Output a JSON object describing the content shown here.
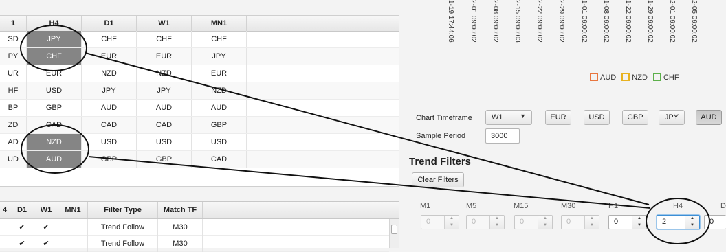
{
  "strength_table": {
    "headers": [
      "1",
      "H4",
      "D1",
      "W1",
      "MN1"
    ],
    "rows": [
      [
        "SD",
        "JPY",
        "CHF",
        "CHF",
        "CHF"
      ],
      [
        "PY",
        "CHF",
        "EUR",
        "EUR",
        "JPY"
      ],
      [
        "UR",
        "EUR",
        "NZD",
        "NZD",
        "EUR"
      ],
      [
        "HF",
        "USD",
        "JPY",
        "JPY",
        "NZD"
      ],
      [
        "BP",
        "GBP",
        "AUD",
        "AUD",
        "AUD"
      ],
      [
        "ZD",
        "CAD",
        "CAD",
        "CAD",
        "GBP"
      ],
      [
        "AD",
        "NZD",
        "USD",
        "USD",
        "USD"
      ],
      [
        "UD",
        "AUD",
        "GBP",
        "GBP",
        "CAD"
      ]
    ]
  },
  "filter_table": {
    "headers": [
      "4",
      "D1",
      "W1",
      "MN1",
      "Filter Type",
      "Match TF"
    ],
    "rows": [
      [
        "",
        "✔",
        "✔",
        "",
        "Trend Follow",
        "M30"
      ],
      [
        "",
        "✔",
        "✔",
        "",
        "Trend Follow",
        "M30"
      ]
    ]
  },
  "chart": {
    "dates": [
      "1-19 17:44:06",
      "2-01 09:00:02",
      "2-08 09:00:02",
      "2-15 09:00:03",
      "2-22 09:00:02",
      "2-29 09:00:02",
      "1-01 09:00:02",
      "1-08 09:00:02",
      "1-22 09:00:02",
      "1-29 09:00:02",
      "2-01 09:00:02",
      "2-05 09:00:02"
    ],
    "legend": [
      {
        "label": "AUD",
        "color": "#e8763f"
      },
      {
        "label": "NZD",
        "color": "#e8b220"
      },
      {
        "label": "CHF",
        "color": "#5cb04a"
      }
    ]
  },
  "controls": {
    "chart_timeframe_label": "Chart Timeframe",
    "chart_timeframe_value": "W1",
    "currency_buttons": [
      "EUR",
      "USD",
      "GBP",
      "JPY",
      "AUD"
    ],
    "selected_currency": "AUD",
    "sample_period_label": "Sample Period",
    "sample_period_value": "3000"
  },
  "trend_filters": {
    "title": "Trend Filters",
    "clear_label": "Clear Filters",
    "timeframes": [
      {
        "label": "M1",
        "value": "0",
        "enabled": false
      },
      {
        "label": "M5",
        "value": "0",
        "enabled": false
      },
      {
        "label": "M15",
        "value": "0",
        "enabled": false
      },
      {
        "label": "M30",
        "value": "0",
        "enabled": false
      },
      {
        "label": "H1",
        "value": "0",
        "enabled": true
      },
      {
        "label": "H4",
        "value": "2",
        "enabled": true
      },
      {
        "label": "D",
        "value": "0",
        "enabled": true
      }
    ]
  }
}
